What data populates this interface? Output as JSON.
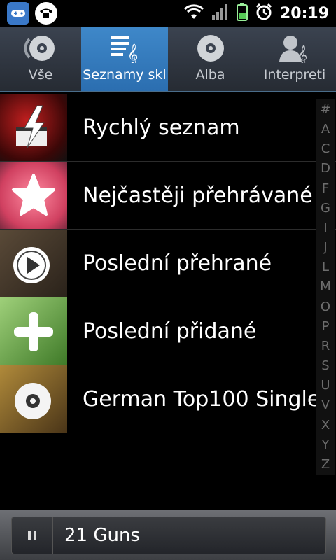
{
  "status": {
    "time": "20:19"
  },
  "tabs": [
    {
      "label": "Vše",
      "icon": "disc-icon"
    },
    {
      "label": "Seznamy skl",
      "icon": "playlist-icon"
    },
    {
      "label": "Alba",
      "icon": "album-icon"
    },
    {
      "label": "Interpreti",
      "icon": "artist-icon"
    }
  ],
  "playlists": [
    {
      "title": "Rychlý seznam",
      "icon": "lightning-icon"
    },
    {
      "title": "Nejčastěji přehrávané",
      "icon": "star-icon"
    },
    {
      "title": "Poslední přehrané",
      "icon": "play-icon"
    },
    {
      "title": "Poslední přidané",
      "icon": "plus-icon"
    },
    {
      "title": "German Top100 Single",
      "icon": "disc-icon"
    }
  ],
  "index_letters": [
    "#",
    "A",
    "C",
    "D",
    "F",
    "G",
    "I",
    "J",
    "L",
    "M",
    "O",
    "P",
    "R",
    "S",
    "U",
    "V",
    "X",
    "Y",
    "Z"
  ],
  "now_playing": {
    "title": "21 Guns"
  },
  "colors": {
    "active_tab": "#2f78bd",
    "background": "#000000"
  }
}
